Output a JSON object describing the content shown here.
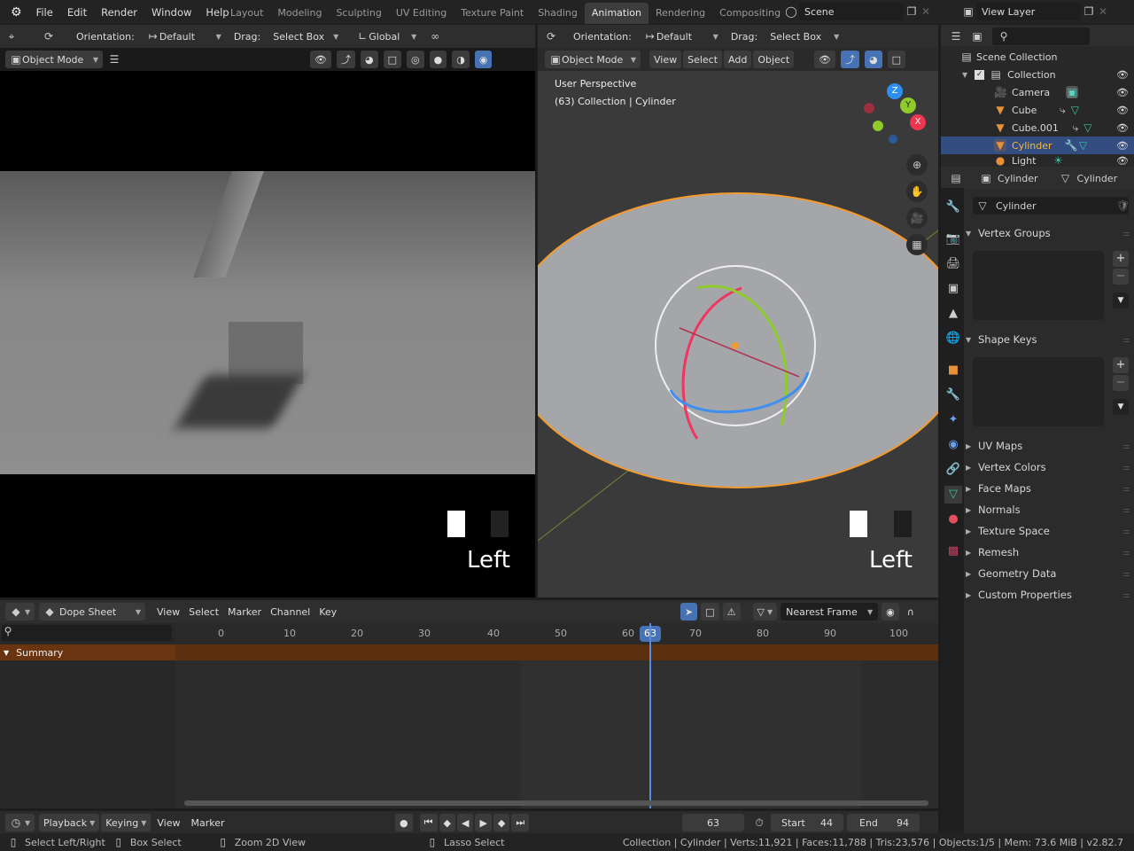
{
  "app": {
    "logo_icon": "blender-logo-icon",
    "menu": [
      "File",
      "Edit",
      "Render",
      "Window",
      "Help"
    ],
    "workspaces": [
      "Layout",
      "Modeling",
      "Sculpting",
      "UV Editing",
      "Texture Paint",
      "Shading",
      "Animation",
      "Rendering",
      "Compositing"
    ],
    "active_workspace": "Animation",
    "scene": "Scene",
    "view_layer": "View Layer"
  },
  "tool_header": {
    "orientation_label": "Orientation:",
    "orientation_value": "Default",
    "drag_label": "Drag:",
    "drag_value": "Select Box",
    "transform_orientation": "Global"
  },
  "viewport_left": {
    "mode": "Object Mode",
    "camera_label": "Left"
  },
  "viewport_right": {
    "mode": "Object Mode",
    "menus": [
      "View",
      "Select",
      "Add",
      "Object"
    ],
    "view_name": "User Perspective",
    "info": "(63) Collection | Cylinder",
    "camera_label": "Left",
    "gizmo_axes": [
      "X",
      "Y",
      "Z"
    ],
    "colors": {
      "x": "#f0354f",
      "y": "#8fcb2b",
      "z": "#2e8ff0",
      "selection": "#f59a2c"
    }
  },
  "outliner": {
    "root": "Scene Collection",
    "collection": "Collection",
    "items": [
      {
        "name": "Camera",
        "type": "camera",
        "selected": false
      },
      {
        "name": "Cube",
        "type": "mesh",
        "selected": false
      },
      {
        "name": "Cube.001",
        "type": "mesh",
        "selected": false
      },
      {
        "name": "Cylinder",
        "type": "mesh",
        "selected": true
      },
      {
        "name": "Light",
        "type": "light",
        "selected": false
      }
    ]
  },
  "properties": {
    "object_name": "Cylinder",
    "data_name": "Cylinder",
    "mesh_field": "Cylinder",
    "panels_open": [
      "Vertex Groups",
      "Shape Keys"
    ],
    "panels_closed": [
      "UV Maps",
      "Vertex Colors",
      "Face Maps",
      "Normals",
      "Texture Space",
      "Remesh",
      "Geometry Data",
      "Custom Properties"
    ]
  },
  "dopesheet": {
    "editor": "Dope Sheet",
    "menus": [
      "View",
      "Select",
      "Marker",
      "Channel",
      "Key"
    ],
    "snap": "Nearest Frame",
    "summary": "Summary",
    "current_frame": "63",
    "ruler": [
      "0",
      "10",
      "20",
      "30",
      "40",
      "50",
      "60",
      "70",
      "80",
      "90",
      "100"
    ]
  },
  "timeline": {
    "menus": [
      "Playback",
      "Keying",
      "View",
      "Marker"
    ],
    "frame": "63",
    "start_label": "Start",
    "start": "44",
    "end_label": "End",
    "end": "94"
  },
  "statusbar": {
    "hints": [
      "Select Left/Right",
      "Box Select",
      "Zoom 2D View",
      "Lasso Select"
    ],
    "stats": "Collection | Cylinder | Verts:11,921 | Faces:11,788 | Tris:23,576 | Objects:1/5 | Mem: 73.6 MiB | v2.82.7"
  }
}
